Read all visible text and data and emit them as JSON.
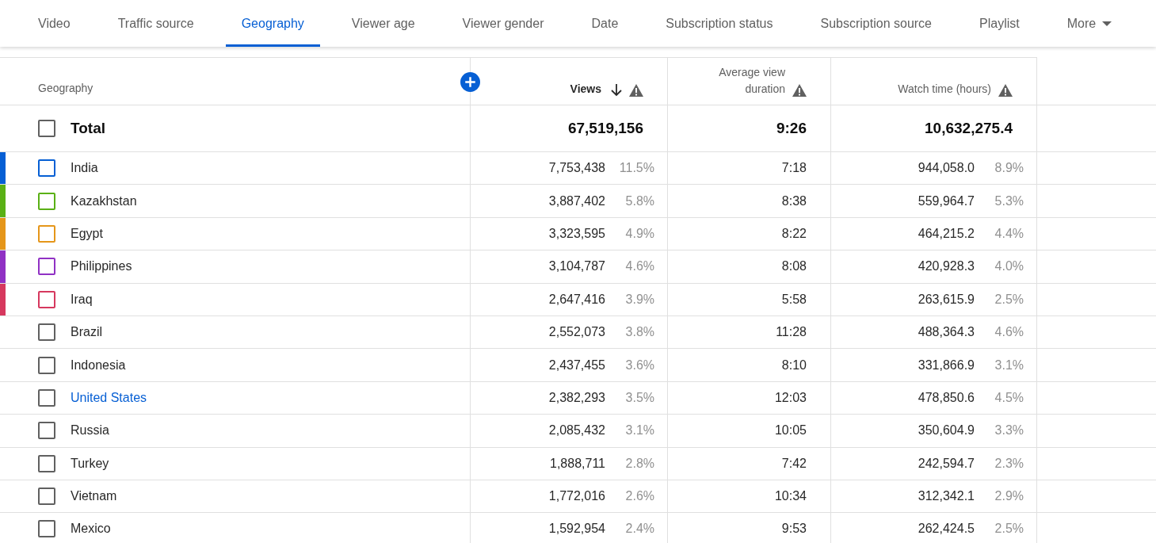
{
  "tabs": [
    {
      "label": "Video",
      "selected": false
    },
    {
      "label": "Traffic source",
      "selected": false
    },
    {
      "label": "Geography",
      "selected": true
    },
    {
      "label": "Viewer age",
      "selected": false
    },
    {
      "label": "Viewer gender",
      "selected": false
    },
    {
      "label": "Date",
      "selected": false
    },
    {
      "label": "Subscription status",
      "selected": false
    },
    {
      "label": "Subscription source",
      "selected": false
    },
    {
      "label": "Playlist",
      "selected": false
    },
    {
      "label": "More",
      "selected": false
    }
  ],
  "table": {
    "columns": [
      {
        "label": "Geography"
      },
      {
        "label": "Views",
        "sorted": true,
        "warning": true
      },
      {
        "label": "Average view duration",
        "warning": true
      },
      {
        "label": "Watch time (hours)",
        "warning": true
      }
    ],
    "total": {
      "label": "Total",
      "checked": false,
      "views": "67,519,156",
      "avg": "9:26",
      "watch": "10,632,275.4"
    },
    "rows": [
      {
        "name": "India",
        "color": "#065fd4",
        "checked": false,
        "hovered": false,
        "views": "7,753,438",
        "views_pct": "11.5%",
        "avg": "7:18",
        "watch": "944,058.0",
        "watch_pct": "8.9%"
      },
      {
        "name": "Kazakhstan",
        "color": "#5ab015",
        "checked": false,
        "hovered": false,
        "views": "3,887,402",
        "views_pct": "5.8%",
        "avg": "8:38",
        "watch": "559,964.7",
        "watch_pct": "5.3%"
      },
      {
        "name": "Egypt",
        "color": "#e5961a",
        "checked": false,
        "hovered": false,
        "views": "3,323,595",
        "views_pct": "4.9%",
        "avg": "8:22",
        "watch": "464,215.2",
        "watch_pct": "4.4%"
      },
      {
        "name": "Philippines",
        "color": "#9031c4",
        "checked": false,
        "hovered": false,
        "views": "3,104,787",
        "views_pct": "4.6%",
        "avg": "8:08",
        "watch": "420,928.3",
        "watch_pct": "4.0%"
      },
      {
        "name": "Iraq",
        "color": "#d6385e",
        "checked": false,
        "hovered": false,
        "views": "2,647,416",
        "views_pct": "3.9%",
        "avg": "5:58",
        "watch": "263,615.9",
        "watch_pct": "2.5%"
      },
      {
        "name": "Brazil",
        "checked": false,
        "hovered": false,
        "views": "2,552,073",
        "views_pct": "3.8%",
        "avg": "11:28",
        "watch": "488,364.3",
        "watch_pct": "4.6%"
      },
      {
        "name": "Indonesia",
        "checked": false,
        "hovered": false,
        "views": "2,437,455",
        "views_pct": "3.6%",
        "avg": "8:10",
        "watch": "331,866.9",
        "watch_pct": "3.1%"
      },
      {
        "name": "United States",
        "checked": false,
        "hovered": true,
        "views": "2,382,293",
        "views_pct": "3.5%",
        "avg": "12:03",
        "watch": "478,850.6",
        "watch_pct": "4.5%"
      },
      {
        "name": "Russia",
        "checked": false,
        "hovered": false,
        "views": "2,085,432",
        "views_pct": "3.1%",
        "avg": "10:05",
        "watch": "350,604.9",
        "watch_pct": "3.3%"
      },
      {
        "name": "Turkey",
        "checked": false,
        "hovered": false,
        "views": "1,888,711",
        "views_pct": "2.8%",
        "avg": "7:42",
        "watch": "242,594.7",
        "watch_pct": "2.3%"
      },
      {
        "name": "Vietnam",
        "checked": false,
        "hovered": false,
        "views": "1,772,016",
        "views_pct": "2.6%",
        "avg": "10:34",
        "watch": "312,342.1",
        "watch_pct": "2.9%"
      },
      {
        "name": "Mexico",
        "checked": false,
        "hovered": false,
        "views": "1,592,954",
        "views_pct": "2.4%",
        "avg": "9:53",
        "watch": "262,424.5",
        "watch_pct": "2.5%"
      }
    ]
  }
}
